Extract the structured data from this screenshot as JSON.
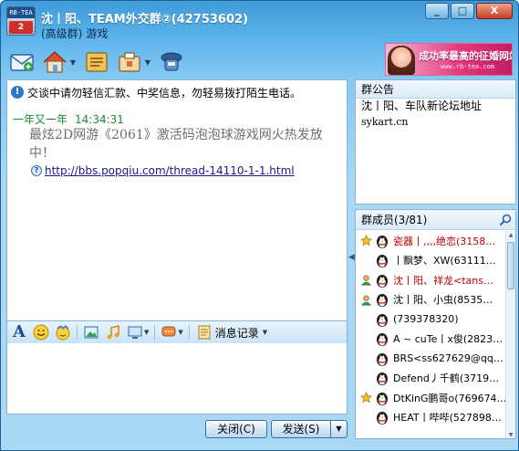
{
  "window": {
    "title": "沈丨阳、TEAM外交群②(42753602)",
    "subtitle_level": "(高级群)",
    "subtitle_category": "游戏",
    "controls": [
      "_",
      "□",
      "X"
    ]
  },
  "toolbar": {
    "icons": [
      "mail-icon",
      "home-icon",
      "file-transfer-icon",
      "apps-icon",
      "settings-icon"
    ]
  },
  "ad": {
    "text": "成功率最高的征婚网站",
    "url": "www.rb-tea.com"
  },
  "chat": {
    "security_notice": "交谈中请勿轻信汇款、中奖信息，勿轻易拨打陌生电话。",
    "messages": [
      {
        "sender": "一年又一年",
        "time": "14:34:31",
        "text": "最炫2D网游《2061》激活码泡泡球游戏网火热发放中！",
        "link": "http://bbs.popqiu.com/thread-14110-1-1.html"
      }
    ]
  },
  "input_toolbar": {
    "font_label": "A",
    "history_label": "消息记录"
  },
  "buttons": {
    "close": "关闭(C)",
    "send": "发送(S)"
  },
  "announcement": {
    "header": "群公告",
    "lines": [
      "沈丨阳、车队新论坛地址",
      "sykart.cn"
    ]
  },
  "members": {
    "header": "群成员(3/81)",
    "items": [
      {
        "badge": "star",
        "name": "瓷器丨,,,,绝恋(3158…",
        "red": true
      },
      {
        "badge": "",
        "name": "丨飘梦、XW(63111…",
        "red": false
      },
      {
        "badge": "admin",
        "name": "沈丨阳、祥龙<tans…",
        "red": true
      },
      {
        "badge": "admin",
        "name": "沈丨阳、小虫(8535…",
        "red": false
      },
      {
        "badge": "",
        "name": "(739378320)",
        "red": false
      },
      {
        "badge": "",
        "name": "A ~ cuTe丨x俊(2823…",
        "red": false
      },
      {
        "badge": "",
        "name": "BRS<ss627629@qq…",
        "red": false
      },
      {
        "badge": "",
        "name": "Defend丿千鹤(3719…",
        "red": false
      },
      {
        "badge": "star",
        "name": "DtKinG鹏哥o(769674…",
        "red": false
      },
      {
        "badge": "",
        "name": "HEAT丨哔哔(527898…",
        "red": false
      }
    ]
  }
}
